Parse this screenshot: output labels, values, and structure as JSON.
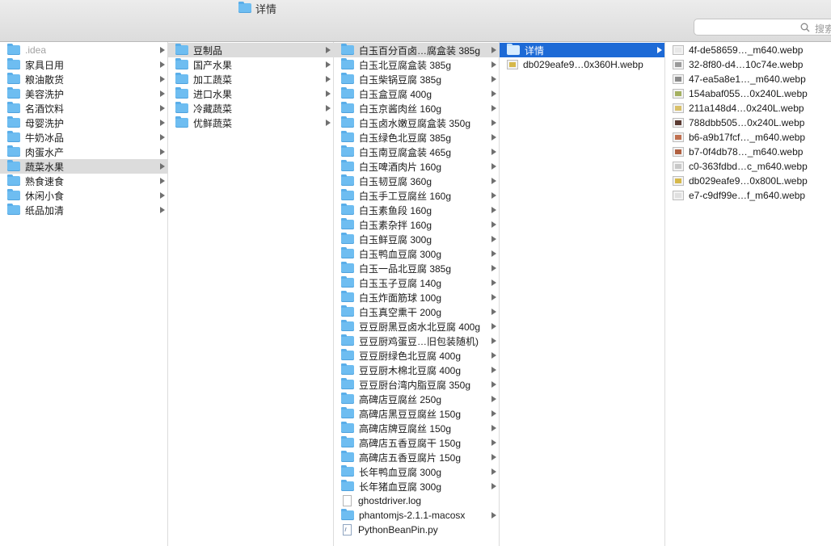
{
  "window": {
    "title": "详情"
  },
  "search": {
    "placeholder": "搜索"
  },
  "column1": {
    "items": [
      {
        "label": ".idea",
        "type": "folder",
        "state": "dim",
        "arrow": true
      },
      {
        "label": "家具日用",
        "type": "folder",
        "arrow": true
      },
      {
        "label": "粮油散货",
        "type": "folder",
        "arrow": true
      },
      {
        "label": "美容洗护",
        "type": "folder",
        "arrow": true
      },
      {
        "label": "名酒饮料",
        "type": "folder",
        "arrow": true
      },
      {
        "label": "母婴洗护",
        "type": "folder",
        "arrow": true
      },
      {
        "label": "牛奶冰品",
        "type": "folder",
        "arrow": true
      },
      {
        "label": "肉蛋水产",
        "type": "folder",
        "arrow": true
      },
      {
        "label": "蔬菜水果",
        "type": "folder",
        "state": "sel-gray",
        "arrow": true
      },
      {
        "label": "熟食速食",
        "type": "folder",
        "arrow": true
      },
      {
        "label": "休闲小食",
        "type": "folder",
        "arrow": true
      },
      {
        "label": "纸品加清",
        "type": "folder",
        "arrow": true
      }
    ]
  },
  "column2": {
    "items": [
      {
        "label": "豆制品",
        "type": "folder",
        "state": "sel-gray",
        "arrow": true
      },
      {
        "label": "国产水果",
        "type": "folder",
        "arrow": true
      },
      {
        "label": "加工蔬菜",
        "type": "folder",
        "arrow": true
      },
      {
        "label": "进口水果",
        "type": "folder",
        "arrow": true
      },
      {
        "label": "冷藏蔬菜",
        "type": "folder",
        "arrow": true
      },
      {
        "label": "优鲜蔬菜",
        "type": "folder",
        "arrow": true
      }
    ]
  },
  "column3": {
    "items": [
      {
        "label": "白玉百分百卤…腐盒装 385g",
        "type": "folder",
        "state": "sel-gray",
        "arrow": true
      },
      {
        "label": "白玉北豆腐盒装 385g",
        "type": "folder",
        "arrow": true
      },
      {
        "label": "白玉柴锅豆腐 385g",
        "type": "folder",
        "arrow": true
      },
      {
        "label": "白玉盒豆腐 400g",
        "type": "folder",
        "arrow": true
      },
      {
        "label": "白玉京酱肉丝 160g",
        "type": "folder",
        "arrow": true
      },
      {
        "label": "白玉卤水嫩豆腐盒装 350g",
        "type": "folder",
        "arrow": true
      },
      {
        "label": "白玉绿色北豆腐 385g",
        "type": "folder",
        "arrow": true
      },
      {
        "label": "白玉南豆腐盒装 465g",
        "type": "folder",
        "arrow": true
      },
      {
        "label": "白玉啤酒肉片 160g",
        "type": "folder",
        "arrow": true
      },
      {
        "label": "白玉韧豆腐 360g",
        "type": "folder",
        "arrow": true
      },
      {
        "label": "白玉手工豆腐丝 160g",
        "type": "folder",
        "arrow": true
      },
      {
        "label": "白玉素鱼段 160g",
        "type": "folder",
        "arrow": true
      },
      {
        "label": "白玉素杂拌 160g",
        "type": "folder",
        "arrow": true
      },
      {
        "label": "白玉鲜豆腐 300g",
        "type": "folder",
        "arrow": true
      },
      {
        "label": "白玉鸭血豆腐 300g",
        "type": "folder",
        "arrow": true
      },
      {
        "label": "白玉一品北豆腐 385g",
        "type": "folder",
        "arrow": true
      },
      {
        "label": "白玉玉子豆腐 140g",
        "type": "folder",
        "arrow": true
      },
      {
        "label": "白玉炸面筋球 100g",
        "type": "folder",
        "arrow": true
      },
      {
        "label": "白玉真空熏干 200g",
        "type": "folder",
        "arrow": true
      },
      {
        "label": "豆豆厨黑豆卤水北豆腐 400g",
        "type": "folder",
        "arrow": true
      },
      {
        "label": "豆豆厨鸡蛋豆…旧包装随机)",
        "type": "folder",
        "arrow": true
      },
      {
        "label": "豆豆厨绿色北豆腐 400g",
        "type": "folder",
        "arrow": true
      },
      {
        "label": "豆豆厨木棉北豆腐 400g",
        "type": "folder",
        "arrow": true
      },
      {
        "label": "豆豆厨台湾内脂豆腐 350g",
        "type": "folder",
        "arrow": true
      },
      {
        "label": "高碑店豆腐丝 250g",
        "type": "folder",
        "arrow": true
      },
      {
        "label": "高碑店黑豆豆腐丝 150g",
        "type": "folder",
        "arrow": true
      },
      {
        "label": "高碑店牌豆腐丝 150g",
        "type": "folder",
        "arrow": true
      },
      {
        "label": "高碑店五香豆腐干 150g",
        "type": "folder",
        "arrow": true
      },
      {
        "label": "高碑店五香豆腐片 150g",
        "type": "folder",
        "arrow": true
      },
      {
        "label": "长年鸭血豆腐 300g",
        "type": "folder",
        "arrow": true
      },
      {
        "label": "长年猪血豆腐 300g",
        "type": "folder",
        "arrow": true
      },
      {
        "label": "ghostdriver.log",
        "type": "doc",
        "arrow": false
      },
      {
        "label": "phantomjs-2.1.1-macosx",
        "type": "folder",
        "arrow": true
      },
      {
        "label": "PythonBeanPin.py",
        "type": "py",
        "arrow": false
      }
    ]
  },
  "column4": {
    "items": [
      {
        "label": "详情",
        "type": "folder",
        "state": "sel-blue",
        "arrow": true
      },
      {
        "label": "db029eafe9…0x360H.webp",
        "type": "thumb",
        "color": "#d6b84a",
        "arrow": false
      }
    ]
  },
  "column5": {
    "items": [
      {
        "label": "4f-de58659…_m640.webp",
        "type": "thumb",
        "color": "#e8e8e8",
        "arrow": false
      },
      {
        "label": "32-8f80-d4…10c74e.webp",
        "type": "thumb",
        "color": "#9a9a9a",
        "arrow": false
      },
      {
        "label": "47-ea5a8e1…_m640.webp",
        "type": "thumb",
        "color": "#8a8a8a",
        "arrow": false
      },
      {
        "label": "154abaf055…0x240L.webp",
        "type": "thumb",
        "color": "#a4b060",
        "arrow": false
      },
      {
        "label": "211a148d4…0x240L.webp",
        "type": "thumb",
        "color": "#d9c06a",
        "arrow": false
      },
      {
        "label": "788dbb505…0x240L.webp",
        "type": "thumb",
        "color": "#5a3a32",
        "arrow": false
      },
      {
        "label": "b6-a9b17fcf…_m640.webp",
        "type": "thumb",
        "color": "#c07050",
        "arrow": false
      },
      {
        "label": "b7-0f4db78…_m640.webp",
        "type": "thumb",
        "color": "#b06040",
        "arrow": false
      },
      {
        "label": "c0-363fdbd…c_m640.webp",
        "type": "thumb",
        "color": "#c8c8c8",
        "arrow": false
      },
      {
        "label": "db029eafe9…0x800L.webp",
        "type": "thumb",
        "color": "#d6b84a",
        "arrow": false
      },
      {
        "label": "e7-c9df99e…f_m640.webp",
        "type": "thumb",
        "color": "#e0e0e0",
        "arrow": false
      }
    ]
  }
}
